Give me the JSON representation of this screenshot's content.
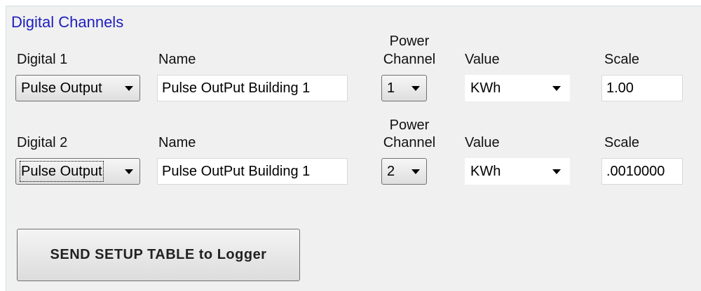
{
  "group": {
    "title": "Digital Channels"
  },
  "rows": [
    {
      "digital_label": "Digital 1",
      "name_label": "Name",
      "power_label_1": "Power",
      "power_label_2": "Channel",
      "value_label": "Value",
      "scale_label": "Scale",
      "type_selected": "Pulse Output",
      "name_value": "Pulse OutPut Building 1",
      "power_channel_selected": "1",
      "value_selected": "KWh",
      "scale_value": "1.00"
    },
    {
      "digital_label": "Digital 2",
      "name_label": "Name",
      "power_label_1": "Power",
      "power_label_2": "Channel",
      "value_label": "Value",
      "scale_label": "Scale",
      "type_selected": "Pulse Output",
      "name_value": "Pulse OutPut Building 1",
      "power_channel_selected": "2",
      "value_selected": "KWh",
      "scale_value": ".0010000"
    }
  ],
  "send_button": {
    "label": "SEND SETUP TABLE to Logger"
  },
  "icons": {
    "dropdown": "chevron-down-icon"
  }
}
